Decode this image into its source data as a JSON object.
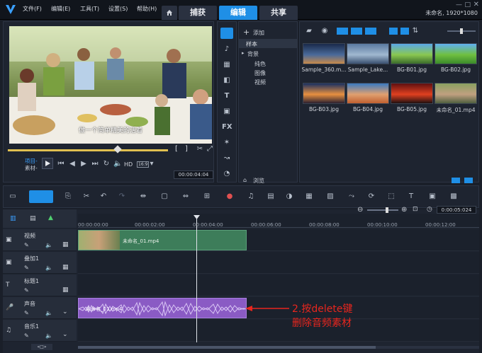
{
  "menu": [
    "文件(F)",
    "编辑(E)",
    "工具(T)",
    "设置(S)",
    "帮助(H)"
  ],
  "tabs": [
    "捕获",
    "编辑",
    "共享"
  ],
  "home_icon": "home-icon",
  "project_info": "未命名, 1920*1080",
  "preview": {
    "subtitle": "做一个简单精美的活着",
    "mode_project": "项目-",
    "mode_clip": "素材-",
    "hd": "HD",
    "ratio": "16:9",
    "timecode": "00:00:04:04",
    "bracket_in": "[",
    "bracket_out": "]"
  },
  "tree": {
    "add": "添加",
    "sample": "样本",
    "background": "背景",
    "solid": "纯色",
    "image": "图像",
    "video": "视频",
    "browse": "浏览"
  },
  "library": {
    "items": [
      {
        "name": "Sample_360.m...",
        "colors": [
          "#1a2a4a",
          "#4a6a9a",
          "#c88a4a"
        ]
      },
      {
        "name": "Sample_Lake...",
        "colors": [
          "#5a7aa0",
          "#a0b8d0",
          "#3a5070"
        ]
      },
      {
        "name": "BG-B01.jpg",
        "colors": [
          "#5aa8e8",
          "#8ac850",
          "#3a6a2a"
        ]
      },
      {
        "name": "BG-B02.jpg",
        "colors": [
          "#60b0f0",
          "#70c040",
          "#3a8a2a"
        ]
      },
      {
        "name": "BG-B03.jpg",
        "colors": [
          "#1a3060",
          "#e89040",
          "#2a2030"
        ]
      },
      {
        "name": "BG-B04.jpg",
        "colors": [
          "#3a7ac0",
          "#e0a070",
          "#c06030"
        ]
      },
      {
        "name": "BG-B05.jpg",
        "colors": [
          "#601010",
          "#e04020",
          "#201010"
        ]
      },
      {
        "name": "未命名_01.mp4",
        "colors": [
          "#8aa060",
          "#c0a080",
          "#506040"
        ]
      }
    ]
  },
  "timeline": {
    "zoom_timecode": "0:00:05:024",
    "ruler": [
      "00:00:00:00",
      "00:00:02:00",
      "00:00:04:00",
      "00:00:06:00",
      "00:00:08:00",
      "00:00:10:00",
      "00:00:12:00"
    ],
    "tracks": [
      {
        "name": "视频"
      },
      {
        "name": "叠加1"
      },
      {
        "name": "标题1"
      },
      {
        "name": "声音"
      },
      {
        "name": "音乐1"
      }
    ],
    "video_clip": "未命名_01.mp4",
    "audio_clip": "未命名_01.mp4",
    "footer_zoom": "«□»"
  },
  "annotation": {
    "line1": "2.按delete键",
    "line2": "删除音频素材",
    "color": "#e8261e"
  },
  "colors": {
    "accent": "#1f8fe6",
    "clip_video": "#3d7d5a",
    "clip_audio": "#8a5bc4"
  }
}
